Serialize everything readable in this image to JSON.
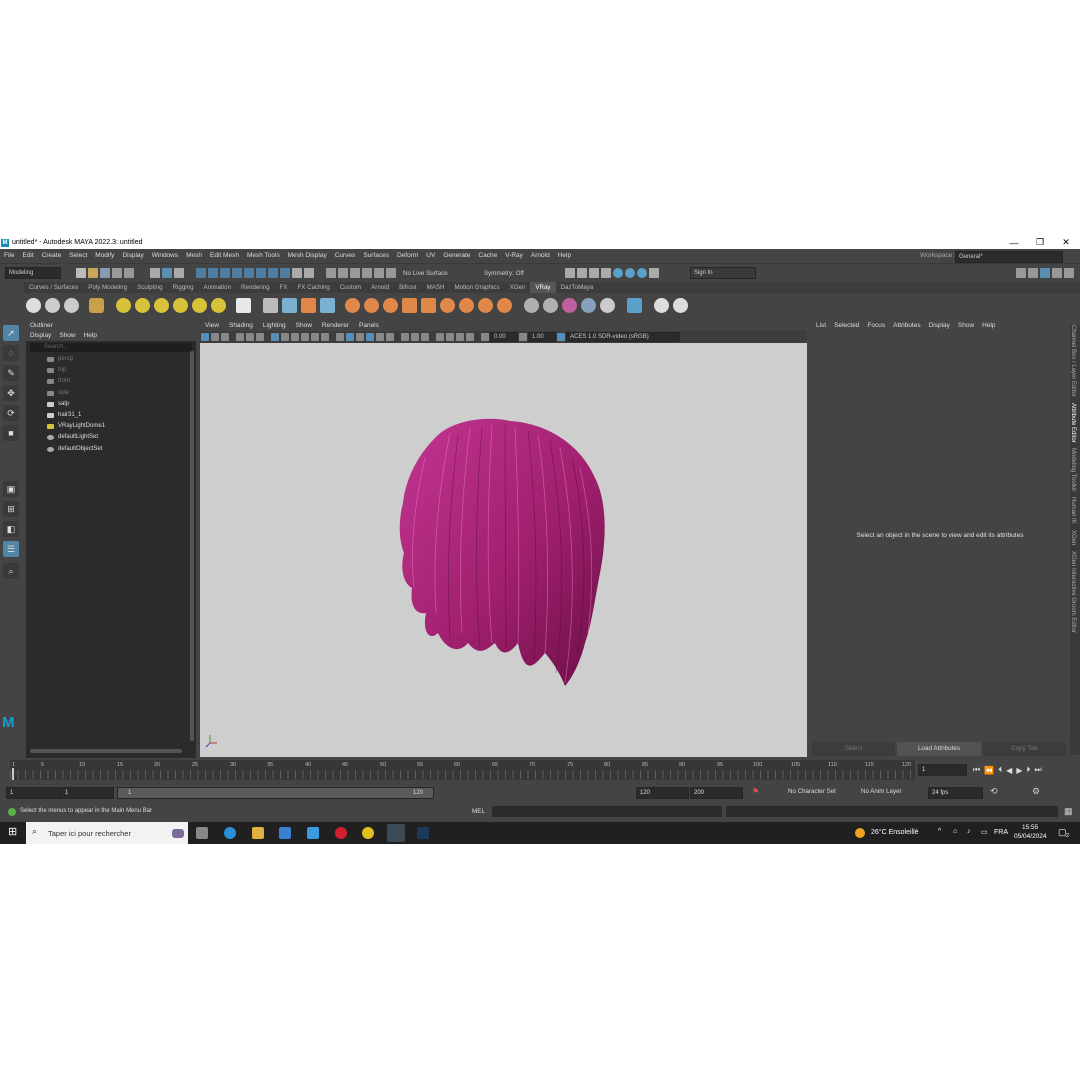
{
  "window": {
    "title": "untitled* - Autodesk MAYA 2022.3: untitled",
    "minimize": "—",
    "restore": "❐",
    "close": "✕"
  },
  "menubar": {
    "items": [
      "File",
      "Edit",
      "Create",
      "Select",
      "Modify",
      "Display",
      "Windows",
      "Mesh",
      "Edit Mesh",
      "Mesh Tools",
      "Mesh Display",
      "Curves",
      "Surfaces",
      "Deform",
      "UV",
      "Generate",
      "Cache",
      "V-Ray",
      "Arnold",
      "Help"
    ],
    "workspace_label": "Workspace:",
    "workspace_value": "General*"
  },
  "statusline": {
    "mode": "Modeling",
    "live_surface": "No Live Surface",
    "symmetry": "Symmetry: Off",
    "sign_in": "Sign In"
  },
  "shelf_tabs": [
    "Curves / Surfaces",
    "Poly Modeling",
    "Sculpting",
    "Rigging",
    "Animation",
    "Rendering",
    "FX",
    "FX Caching",
    "Custom",
    "Arnold",
    "Bifrost",
    "MASH",
    "Motion Graphics",
    "XGen",
    "VRay",
    "DazToMaya"
  ],
  "active_shelf": "VRay",
  "outliner": {
    "title": "Outliner",
    "menu": [
      "Display",
      "Show",
      "Help"
    ],
    "search_placeholder": "Search...",
    "items": [
      {
        "label": "persp",
        "dim": true
      },
      {
        "label": "top",
        "dim": true
      },
      {
        "label": "front",
        "dim": true
      },
      {
        "label": "side",
        "dim": true
      },
      {
        "label": "salp",
        "dim": false
      },
      {
        "label": "hair31_1",
        "dim": false
      },
      {
        "label": "VRayLightDome1",
        "dim": false
      },
      {
        "label": "defaultLightSet",
        "dim": false
      },
      {
        "label": "defaultObjectSet",
        "dim": false
      }
    ]
  },
  "viewport": {
    "menu": [
      "View",
      "Shading",
      "Lighting",
      "Show",
      "Renderer",
      "Panels"
    ],
    "exposure": "0.00",
    "gamma": "1.00",
    "color_space": "ACES 1.0 SDR-video (sRGB)",
    "hair_color": "#b3287e"
  },
  "attribute_editor": {
    "menu": [
      "List",
      "Selected",
      "Focus",
      "Attributes",
      "Display",
      "Show",
      "Help"
    ],
    "message": "Select an object in the scene to view and edit its attributes",
    "buttons": [
      "Select",
      "Load Attributes",
      "Copy Tab"
    ]
  },
  "side_tabs": [
    "Channel Box / Layer Editor",
    "Attribute Editor",
    "Modeling Toolkit",
    "Human IK",
    "XGen",
    "XGen Interactive Groom Editor"
  ],
  "timeline": {
    "ticks": [
      "1",
      "5",
      "10",
      "15",
      "20",
      "25",
      "30",
      "35",
      "40",
      "45",
      "50",
      "55",
      "60",
      "65",
      "70",
      "75",
      "80",
      "85",
      "90",
      "95",
      "100",
      "105",
      "110",
      "115",
      "120"
    ],
    "current_frame": "1"
  },
  "range": {
    "start": "1",
    "playback_start": "1",
    "slider_start": "1",
    "slider_end": "120",
    "playback_end": "120",
    "end": "200",
    "character_set": "No Character Set",
    "anim_layer": "No Anim Layer",
    "fps": "24 fps"
  },
  "status": {
    "help_line": "Select the menus to appear in the Main Menu Bar",
    "script_lang": "MEL"
  },
  "taskbar": {
    "search_placeholder": "Taper ici pour rechercher",
    "weather": "26°C  Ensoleillé",
    "language": "FRA",
    "time": "15:55",
    "date": "05/04/2024",
    "notifications": "2"
  }
}
